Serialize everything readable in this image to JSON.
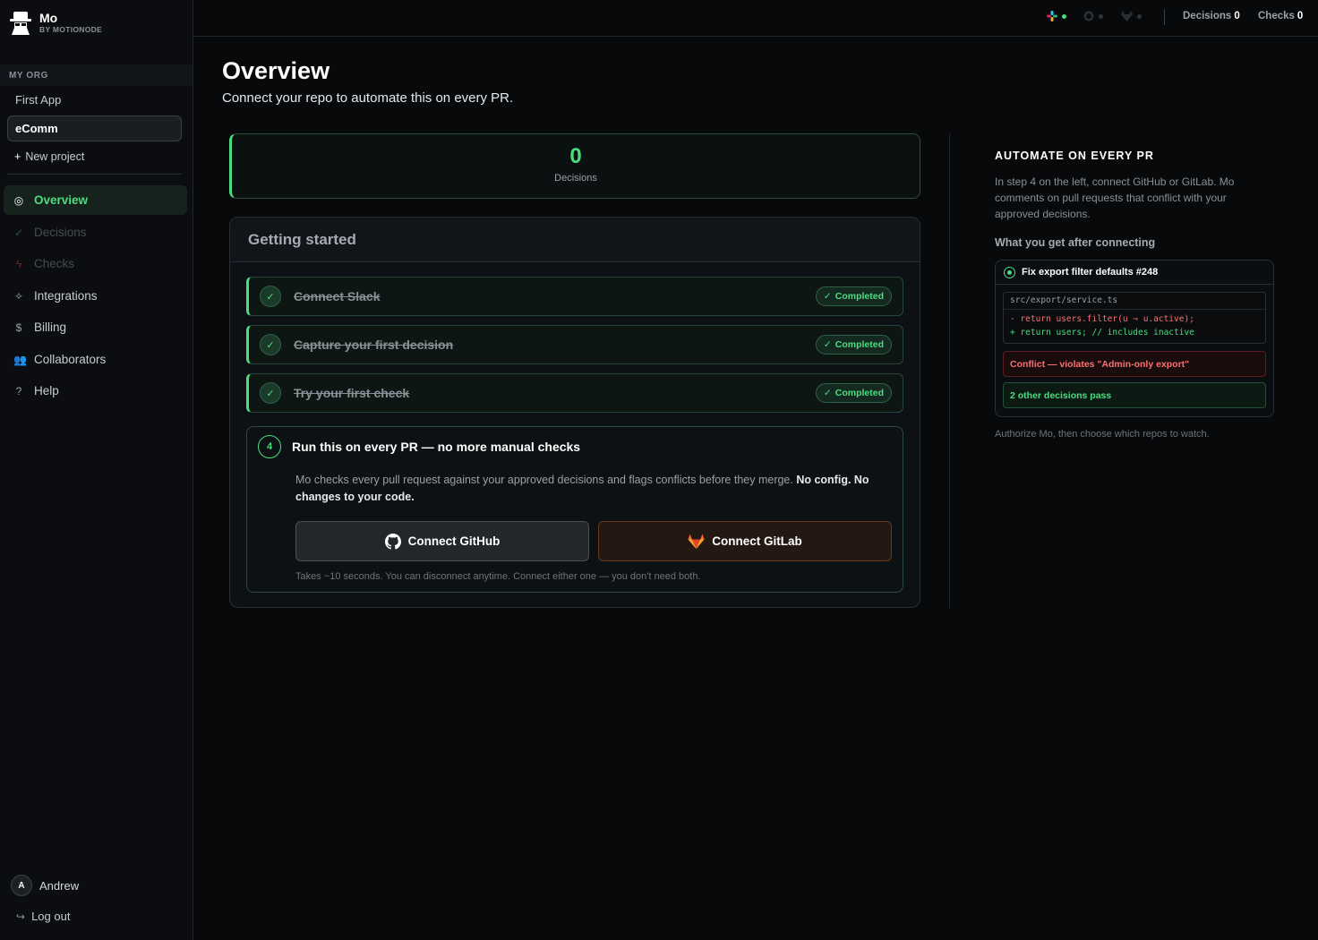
{
  "brand": {
    "name": "Mo",
    "sub": "BY MOTIONODE"
  },
  "sidebar": {
    "org_label": "MY ORG",
    "projects": [
      "First App",
      "eComm"
    ],
    "active_project": "eComm",
    "new_project": "New project",
    "nav": [
      {
        "label": "Overview",
        "icon": "overview-icon",
        "state": "active"
      },
      {
        "label": "Decisions",
        "icon": "check-icon",
        "state": "disabled"
      },
      {
        "label": "Checks",
        "icon": "bolt-icon",
        "state": "disabled"
      },
      {
        "label": "Integrations",
        "icon": "diamond-icon",
        "state": "normal"
      },
      {
        "label": "Billing",
        "icon": "dollar-icon",
        "state": "normal"
      },
      {
        "label": "Collaborators",
        "icon": "people-icon",
        "state": "normal"
      },
      {
        "label": "Help",
        "icon": "help-icon",
        "state": "normal"
      }
    ],
    "user": {
      "initial": "A",
      "name": "Andrew"
    },
    "logout": "Log out"
  },
  "topbar": {
    "integrations": [
      {
        "name": "slack-icon",
        "connected": true
      },
      {
        "name": "github-icon",
        "connected": false
      },
      {
        "name": "gitlab-icon",
        "connected": false
      }
    ],
    "decisions_label": "Decisions",
    "decisions_count": "0",
    "checks_label": "Checks",
    "checks_count": "0"
  },
  "main": {
    "title": "Overview",
    "subtitle": "Connect your repo to automate this on every PR.",
    "stat": {
      "value": "0",
      "label": "Decisions"
    },
    "getting_started": {
      "title": "Getting started",
      "steps": [
        {
          "title": "Connect Slack",
          "status": "Completed"
        },
        {
          "title": "Capture your first decision",
          "status": "Completed"
        },
        {
          "title": "Try your first check",
          "status": "Completed"
        }
      ],
      "step4": {
        "number": "4",
        "title": "Run this on every PR — no more manual checks",
        "desc_main": "Mo checks every pull request against your approved decisions and flags conflicts before they merge. ",
        "desc_bold": "No config. No changes to your code.",
        "github_button": "Connect GitHub",
        "gitlab_button": "Connect GitLab",
        "footnote": "Takes ~10 seconds. You can disconnect anytime. Connect either one — you don't need both."
      }
    }
  },
  "right_panel": {
    "title": "AUTOMATE ON EVERY PR",
    "description": "In step 4 on the left, connect GitHub or GitLab. Mo comments on pull requests that conflict with your approved decisions.",
    "subtitle": "What you get after connecting",
    "pr": {
      "title": "Fix export filter defaults #248",
      "file": "src/export/service.ts",
      "removed": "- return users.filter(u ⇒ u.active);",
      "added": "+ return users; // includes inactive",
      "conflict": "Conflict — violates \"Admin-only export\"",
      "pass": "2 other decisions pass"
    },
    "footnote": "Authorize Mo, then choose which repos to watch."
  },
  "colors": {
    "accent": "#4ade80",
    "danger": "#f87171",
    "gitlab": "#fc6d26",
    "background": "#07090b"
  }
}
